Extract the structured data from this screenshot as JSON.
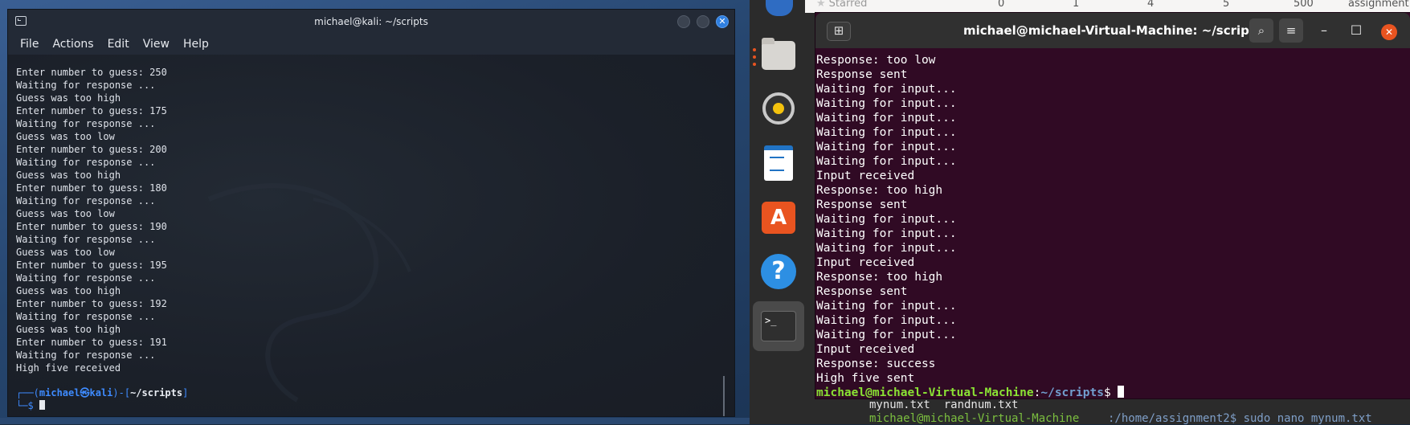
{
  "kali": {
    "title": "michael@kali: ~/scripts",
    "menu": [
      "File",
      "Actions",
      "Edit",
      "View",
      "Help"
    ],
    "lines": [
      "Enter number to guess: 250",
      "Waiting for response ...",
      "Guess was too high",
      "Enter number to guess: 175",
      "Waiting for response ...",
      "Guess was too low",
      "Enter number to guess: 200",
      "Waiting for response ...",
      "Guess was too high",
      "Enter number to guess: 180",
      "Waiting for response ...",
      "Guess was too low",
      "Enter number to guess: 190",
      "Waiting for response ...",
      "Guess was too low",
      "Enter number to guess: 195",
      "Waiting for response ...",
      "Guess was too high",
      "Enter number to guess: 192",
      "Waiting for response ...",
      "Guess was too high",
      "Enter number to guess: 191",
      "Waiting for response ...",
      "High five received"
    ],
    "prompt": {
      "open": "┌──(",
      "user": "michael㉿kali",
      "mid": ")-[",
      "path": "~/scripts",
      "close": "]",
      "second": "└─$ "
    }
  },
  "files_header": {
    "starred": "Starred",
    "cells": [
      "0",
      "1",
      "4",
      "5",
      "500",
      "assignment"
    ]
  },
  "ubuntu": {
    "title": "michael@michael-Virtual-Machine: ~/scripts",
    "lines": [
      "Response: too low",
      "Response sent",
      "Waiting for input...",
      "Waiting for input...",
      "Waiting for input...",
      "Waiting for input...",
      "Waiting for input...",
      "Waiting for input...",
      "Input received",
      "Response: too high",
      "Response sent",
      "Waiting for input...",
      "Waiting for input...",
      "Waiting for input...",
      "Input received",
      "Response: too high",
      "Response sent",
      "Waiting for input...",
      "Waiting for input...",
      "Waiting for input...",
      "Input received",
      "Response: success",
      "High five sent"
    ],
    "prompt": {
      "user": "michael@michael-Virtual-Machine",
      "sep": ":",
      "path": "~/scripts",
      "end": "$ "
    }
  },
  "background_terminal": {
    "line1": "mynum.txt  randnum.txt",
    "line2_user": "michael@michael-Virtual-Machine",
    "line2_rest": ":/home/assignment2$ sudo nano mynum.txt"
  },
  "dock": {
    "items": [
      "files-icon",
      "rhythmbox-icon",
      "writer-icon",
      "software-store-icon",
      "help-icon",
      "terminal-icon"
    ],
    "terminal_glyph": ">_",
    "store_glyph": "A",
    "help_glyph": "?"
  },
  "colors": {
    "kali_prompt": "#3e8bff",
    "ubuntu_bg": "#300a24",
    "ubuntu_user": "#8ae234",
    "ubuntu_path": "#729fcf",
    "ubuntu_accent": "#e95420"
  }
}
